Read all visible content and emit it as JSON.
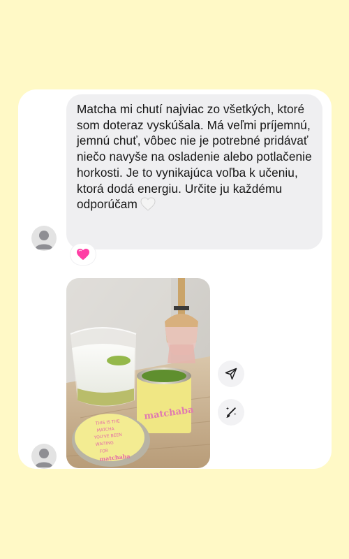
{
  "message": {
    "text": "Matcha mi chutí najviac zo všetkých, ktoré som doteraz vyskúšala. Má veľmi príjemnú, jemnú chuť, vôbec nie je potrebné pridávať niečo navyše na osladenie alebo potlačenie horkosti. Je to vynikajúca voľba k učeniu, ktorá dodá energiu. Určite ju každému odporúčam",
    "trailing_emoji": "white-heart-icon"
  },
  "reaction": {
    "emoji": "pink-heart-icon"
  },
  "photo": {
    "lid_text": "THIS IS THE MATCHA YOU'VE BEEN WAITING FOR",
    "lid_brand": "matchaba",
    "tin_brand": "matchaba"
  },
  "actions": [
    {
      "icon": "send-icon"
    },
    {
      "icon": "sparkle-brush-icon"
    }
  ],
  "colors": {
    "background": "#fff9c6",
    "bubble": "#efeff1",
    "reaction_heart": "#ff3ea5"
  }
}
